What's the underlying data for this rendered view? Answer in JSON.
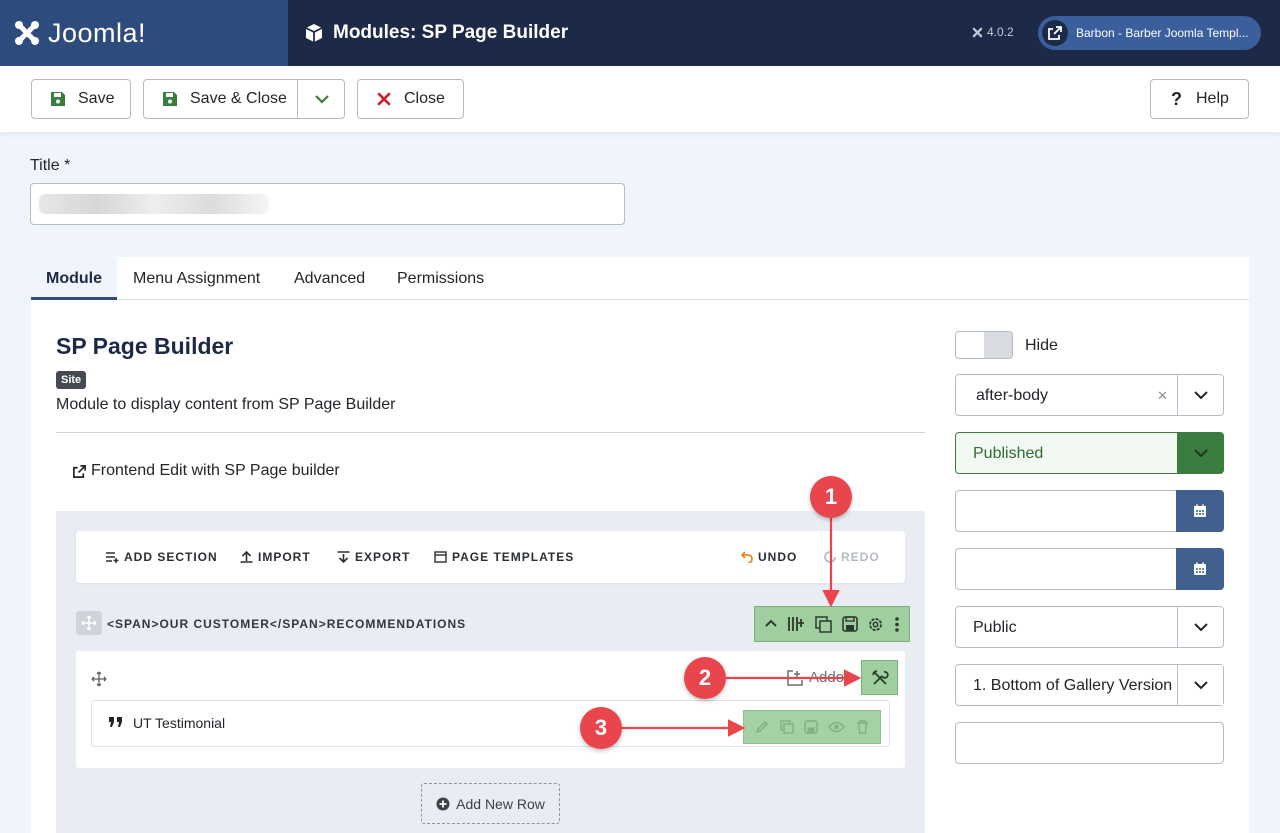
{
  "header": {
    "brand": "Joomla!",
    "page_title": "Modules: SP Page Builder",
    "version": "4.0.2",
    "site_name": "Barbon - Barber Joomla Templ..."
  },
  "toolbar": {
    "save_label": "Save",
    "save_close_label": "Save & Close",
    "close_label": "Close",
    "help_label": "Help"
  },
  "form": {
    "title_label": "Title *",
    "title_value": ""
  },
  "tabs": [
    {
      "label": "Module"
    },
    {
      "label": "Menu Assignment"
    },
    {
      "label": "Advanced"
    },
    {
      "label": "Permissions"
    }
  ],
  "module": {
    "name": "SP Page Builder",
    "badge": "Site",
    "description": "Module to display content from SP Page Builder",
    "frontend_edit": "Frontend Edit with SP Page builder"
  },
  "builder": {
    "toolbar": {
      "add_section": "ADD SECTION",
      "import": "IMPORT",
      "export": "EXPORT",
      "page_templates": "PAGE TEMPLATES",
      "undo": "UNDO",
      "redo": "REDO"
    },
    "section_title": "<SPAN>OUR CUSTOMER</SPAN>RECOMMENDATIONS",
    "addon_button": "Addon",
    "addon_name": "UT Testimonial",
    "add_new_row": "Add New Row"
  },
  "sidebar": {
    "toggle_label": "Hide",
    "position": "after-body",
    "status": "Published",
    "access": "Public",
    "ordering": "1. Bottom of Gallery Version"
  },
  "callouts": [
    "1",
    "2",
    "3"
  ],
  "colors": {
    "header_bg": "#1c2a48",
    "brand_bg": "#2e4b7e",
    "published": "#3a7d3e",
    "tool_green": "#9fce9f",
    "callout_red": "#e8464c"
  }
}
